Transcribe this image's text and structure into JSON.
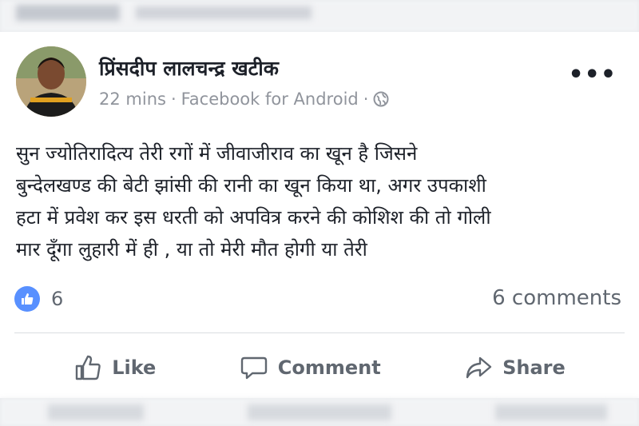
{
  "post": {
    "author": "प्रिंसदीप लालचन्द्र खटीक",
    "time": "22 mins",
    "separator1": "·",
    "source": "Facebook for Android",
    "separator2": "·",
    "privacy_icon": "globe-icon",
    "more_icon": "•••",
    "text_lines": [
      "सुन ज्योतिरादित्य तेरी रगों में जीवाजीराव का खून है जिसने",
      "बुन्देलखण्ड की बेटी झांसी की रानी का खून किया था, अगर उपकाशी",
      "हटा में प्रवेश कर इस धरती को अपवित्र करने की कोशिश की तो गोली",
      "मार दूँगा लुहारी में ही , या तो मेरी मौत होगी या तेरी"
    ]
  },
  "stats": {
    "like_count": "6",
    "comments": "6 comments"
  },
  "actions": {
    "like": "Like",
    "comment": "Comment",
    "share": "Share"
  },
  "colors": {
    "accent": "#5890ff",
    "text": "#1d2129",
    "muted": "#606770"
  }
}
